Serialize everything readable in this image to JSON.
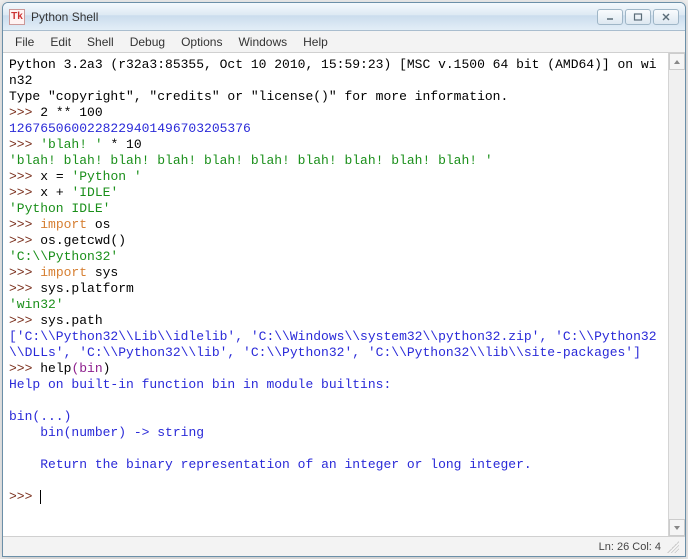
{
  "window": {
    "title": "Python Shell",
    "icon_label": "Tk"
  },
  "menu": {
    "items": [
      "File",
      "Edit",
      "Shell",
      "Debug",
      "Options",
      "Windows",
      "Help"
    ]
  },
  "status": {
    "text": "Ln: 26 Col: 4"
  },
  "shell": {
    "banner_l1": "Python 3.2a3 (r32a3:85355, Oct 10 2010, 15:59:23) [MSC v.1500 64 bit (AMD64)] on win32",
    "banner_l2": "Type \"copyright\", \"credits\" or \"license()\" for more information.",
    "prompt": ">>>",
    "lines": {
      "cmd1": "2 ** 100",
      "out1": "1267650600228229401496703205376",
      "cmd2a": "'blah! '",
      "cmd2b": " * 10",
      "out2": "'blah! blah! blah! blah! blah! blah! blah! blah! blah! blah! '",
      "cmd3a": "x = ",
      "cmd3b": "'Python '",
      "cmd4a": "x + ",
      "cmd4b": "'IDLE'",
      "out4": "'Python IDLE'",
      "cmd5a": "import",
      "cmd5b": " os",
      "cmd6": "os.getcwd()",
      "out6": "'C:\\\\Python32'",
      "cmd7a": "import",
      "cmd7b": " sys",
      "cmd8": "sys.platform",
      "out8": "'win32'",
      "cmd9": "sys.path",
      "out9": "['C:\\\\Python32\\\\Lib\\\\idlelib', 'C:\\\\Windows\\\\system32\\\\python32.zip', 'C:\\\\Python32\\\\DLLs', 'C:\\\\Python32\\\\lib', 'C:\\\\Python32', 'C:\\\\Python32\\\\lib\\\\site-packages']",
      "cmd10a": "help",
      "cmd10b": "(",
      "cmd10c": "bin",
      "cmd10d": ")",
      "help1": "Help on built-in function bin in module builtins:",
      "help2": "bin(...)",
      "help3": "    bin(number) -> string",
      "help4": "    Return the binary representation of an integer or long integer."
    }
  }
}
